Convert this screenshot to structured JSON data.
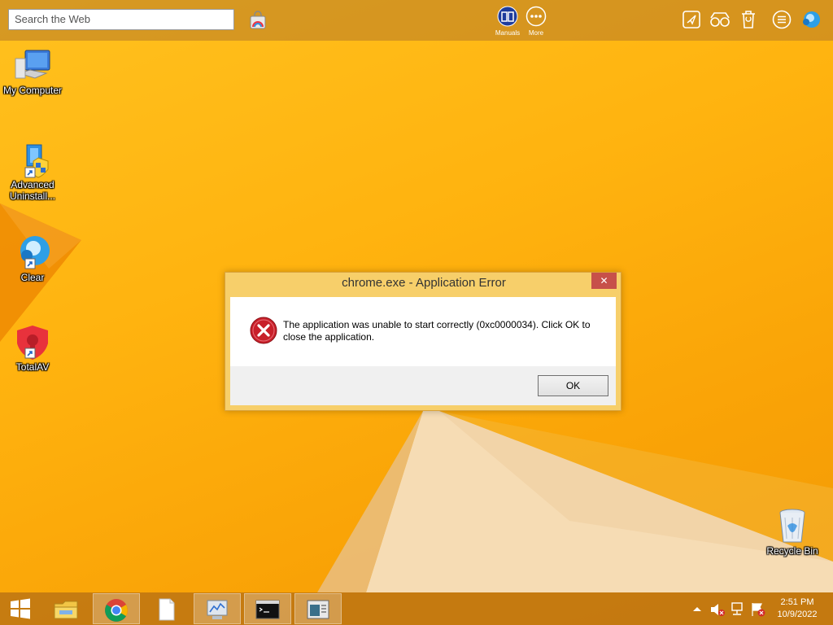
{
  "topbar": {
    "search_placeholder": "Search the Web",
    "manuals_label": "Manuals",
    "more_label": "More"
  },
  "desktop_icons": [
    {
      "label": "My Computer"
    },
    {
      "label": "Advanced Uninstall..."
    },
    {
      "label": "Clear"
    },
    {
      "label": "TotalAV"
    },
    {
      "label": "Recycle Bin"
    }
  ],
  "dialog": {
    "title": "chrome.exe - Application Error",
    "close_glyph": "✕",
    "message": "The application was unable to start correctly (0xc0000034). Click OK to close the application.",
    "ok_label": "OK"
  },
  "taskbar": {
    "time": "2:51 PM",
    "date": "10/9/2022"
  },
  "colors": {
    "wallpaper": "#ffb30f",
    "close_button": "#c7504a",
    "error_icon": "#c8202a"
  }
}
